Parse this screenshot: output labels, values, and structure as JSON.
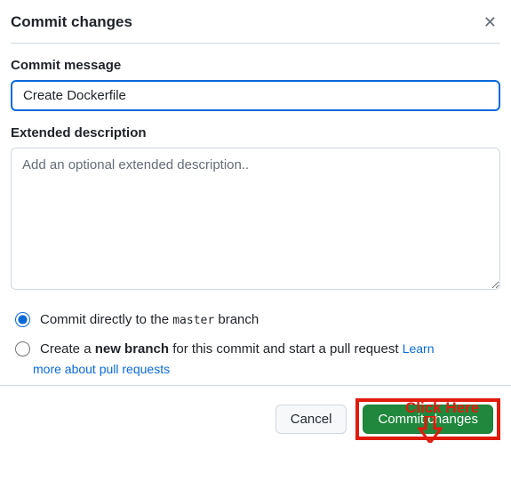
{
  "header": {
    "title": "Commit changes"
  },
  "form": {
    "message_label": "Commit message",
    "message_value": "Create Dockerfile",
    "desc_label": "Extended description",
    "desc_placeholder": "Add an optional extended description.."
  },
  "radios": {
    "direct_prefix": "Commit directly to the ",
    "direct_branch": "master",
    "direct_suffix": " branch",
    "newbranch_prefix": "Create a ",
    "newbranch_bold": "new branch",
    "newbranch_suffix": " for this commit and start a pull request ",
    "learn_link_word": "Learn",
    "learn_link_rest": "more about pull requests"
  },
  "footer": {
    "cancel": "Cancel",
    "commit": "Commit changes"
  },
  "annotation": {
    "click_here": "Click Here"
  }
}
